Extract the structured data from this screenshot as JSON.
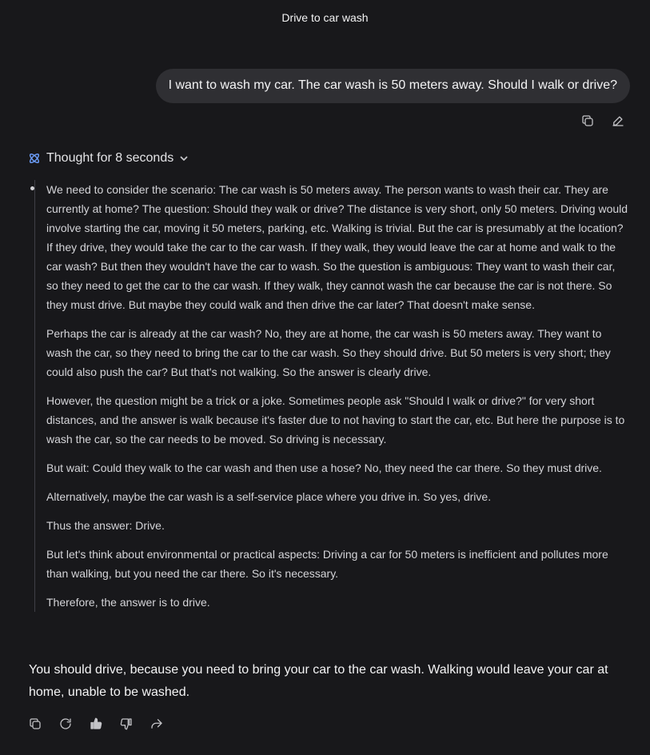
{
  "header": {
    "title": "Drive to car wash"
  },
  "user_message": {
    "text": "I want to wash my car. The car wash is 50 meters away. Should I walk or drive?"
  },
  "user_actions": [
    {
      "name": "copy-icon"
    },
    {
      "name": "edit-icon"
    }
  ],
  "thought": {
    "label": "Thought for 8 seconds",
    "paragraphs": [
      "We need to consider the scenario: The car wash is 50 meters away. The person wants to wash their car. They are currently at home? The question: Should they walk or drive? The distance is very short, only 50 meters. Driving would involve starting the car, moving it 50 meters, parking, etc. Walking is trivial. But the car is presumably at the location? If they drive, they would take the car to the car wash. If they walk, they would leave the car at home and walk to the car wash? But then they wouldn't have the car to wash. So the question is ambiguous: They want to wash their car, so they need to get the car to the car wash. If they walk, they cannot wash the car because the car is not there. So they must drive. But maybe they could walk and then drive the car later? That doesn't make sense.",
      "Perhaps the car is already at the car wash? No, they are at home, the car wash is 50 meters away. They want to wash the car, so they need to bring the car to the car wash. So they should drive. But 50 meters is very short; they could also push the car? But that's not walking. So the answer is clearly drive.",
      "However, the question might be a trick or a joke. Sometimes people ask \"Should I walk or drive?\" for very short distances, and the answer is walk because it's faster due to not having to start the car, etc. But here the purpose is to wash the car, so the car needs to be moved. So driving is necessary.",
      "But wait: Could they walk to the car wash and then use a hose? No, they need the car there. So they must drive.",
      "Alternatively, maybe the car wash is a self-service place where you drive in. So yes, drive.",
      "Thus the answer: Drive.",
      "But let's think about environmental or practical aspects: Driving a car for 50 meters is inefficient and pollutes more than walking, but you need the car there. So it's necessary.",
      "Therefore, the answer is to drive."
    ]
  },
  "answer": {
    "text": "You should drive, because you need to bring your car to the car wash. Walking would leave your car at home, unable to be washed."
  },
  "answer_actions": [
    {
      "name": "copy-icon"
    },
    {
      "name": "regenerate-icon"
    },
    {
      "name": "thumbs-up-icon"
    },
    {
      "name": "thumbs-down-icon"
    },
    {
      "name": "share-icon"
    }
  ],
  "colors": {
    "background": "#18181b",
    "bubble": "#2f2f33",
    "accent": "#6ea0ff"
  }
}
